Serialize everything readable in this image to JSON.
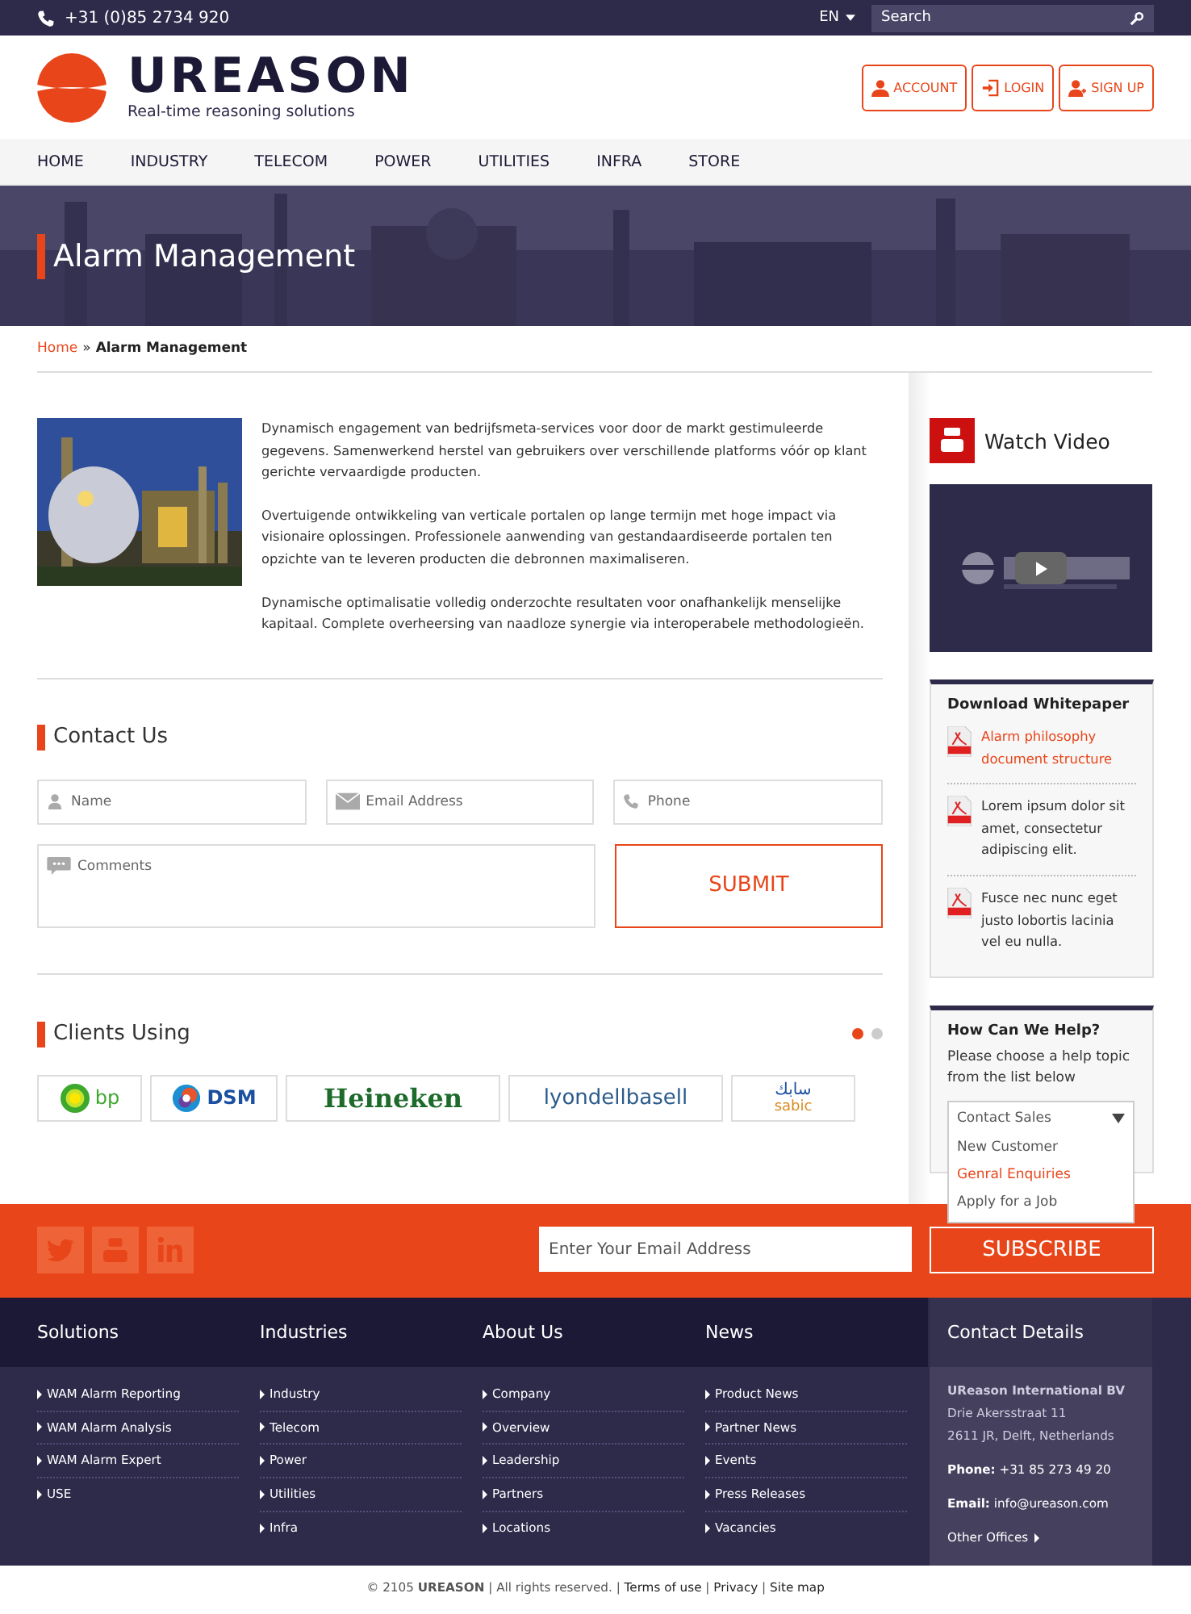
{
  "top_bar": {
    "phone": "+31 (0)85 2734 920",
    "language": "EN",
    "search": {
      "placeholder": "Search"
    }
  },
  "header": {
    "logo": {
      "name": "UREASON",
      "tagline": "Real-time reasoning solutions"
    },
    "buttons": [
      {
        "kind": "account",
        "label": "ACCOUNT"
      },
      {
        "kind": "login",
        "label": "LOGIN"
      },
      {
        "kind": "signup",
        "label": "SIGN UP"
      }
    ]
  },
  "nav": [
    "HOME",
    "INDUSTRY",
    "TELECOM",
    "POWER",
    "UTILITIES",
    "INFRA",
    "STORE"
  ],
  "hero": {
    "title": "Alarm Management"
  },
  "breadcrumb": {
    "home": "Home",
    "separator": "»",
    "current": "Alarm Management"
  },
  "article": {
    "image": {
      "kind": "picture"
    },
    "paragraphs": [
      "Dynamisch engagement van bedrijfsmeta-services voor door de markt gestimuleerde gegevens. Samenwerkend herstel van gebruikers over verschillende platforms vóór op klant gerichte vervaardigde producten.",
      "Overtuigende ontwikkeling van verticale portalen op lange termijn met hoge impact via visionaire oplossingen. Professionele aanwending van gestandaardiseerde portalen ten opzichte van te leveren producten die debronnen maximaliseren.",
      "Dynamische optimalisatie volledig onderzochte resultaten voor onafhankelijk menselijke kapitaal. Complete overheersing van naadloze synergie via interoperabele methodologieën."
    ]
  },
  "contact": {
    "title": "Contact Us",
    "fields": [
      {
        "kind": "name",
        "placeholder": "Name"
      },
      {
        "kind": "email",
        "placeholder": "Email Address"
      },
      {
        "kind": "phone",
        "placeholder": "Phone"
      }
    ],
    "comments": {
      "placeholder": "Comments"
    },
    "submit": "SUBMIT"
  },
  "clients": {
    "title": "Clients Using",
    "dots": [
      {
        "selected": true
      },
      {
        "selected": false
      }
    ],
    "logos": [
      {
        "kind": "bp",
        "texts": [
          "bp"
        ]
      },
      {
        "kind": "dsm",
        "texts": [
          "DSM"
        ]
      },
      {
        "kind": "heineken",
        "texts": [
          "Heineken"
        ]
      },
      {
        "kind": "lyondellbasell",
        "texts": [
          "lyondellbasell"
        ]
      },
      {
        "kind": "sabic",
        "texts": [
          "سابك",
          "sabic"
        ]
      }
    ]
  },
  "sidebar": {
    "video": {
      "title": "Watch Video"
    },
    "whitepaper": {
      "title": "Download Whitepaper",
      "items": [
        {
          "text": "Alarm philosophy document structure",
          "highlighted": true
        },
        {
          "text": "Lorem ipsum dolor sit amet, consectetur adipiscing elit.",
          "highlighted": false
        },
        {
          "text": "Fusce nec nunc eget justo lobortis lacinia vel eu nulla.",
          "highlighted": false
        }
      ]
    },
    "help": {
      "title": "How Can We Help?",
      "text": "Please choose a help topic from the list below",
      "dropdown": {
        "value": "Contact Sales",
        "expanded": true,
        "options": [
          {
            "label": "New Customer",
            "selected": false
          },
          {
            "label": "Genral Enquiries",
            "selected": true
          },
          {
            "label": "Apply for a Job",
            "selected": false
          }
        ]
      }
    }
  },
  "newsletter": {
    "placeholder": "Enter Your Email Address",
    "button": "SUBSCRIBE"
  },
  "footer": {
    "columns": [
      {
        "title": "Solutions",
        "links": [
          "WAM Alarm Reporting",
          "WAM Alarm Analysis",
          "WAM Alarm Expert",
          "USE"
        ]
      },
      {
        "title": "Industries",
        "links": [
          "Industry",
          "Telecom",
          "Power",
          "Utilities",
          "Infra"
        ]
      },
      {
        "title": "About Us",
        "links": [
          "Company",
          "Overview",
          "Leadership",
          "Partners",
          "Locations"
        ]
      },
      {
        "title": "News",
        "links": [
          "Product News",
          "Partner News",
          "Events",
          "Press Releases",
          "Vacancies"
        ]
      }
    ],
    "contact": {
      "title": "Contact Details",
      "company": "UReason International BV",
      "address": [
        "Drie Akersstraat 11",
        "2611 JR, Delft, Netherlands"
      ],
      "phone": {
        "label": "Phone:",
        "value": "+31 85 273 49 20"
      },
      "email": {
        "label": "Email:",
        "value": "info@ureason.com"
      },
      "other": "Other Offices"
    }
  },
  "copyright": {
    "text": "© 2105",
    "brand": "UREASON",
    "rights": "| All rights reserved. |",
    "links": [
      "Terms of use",
      "Privacy",
      "Site map"
    ],
    "separator": "|"
  }
}
